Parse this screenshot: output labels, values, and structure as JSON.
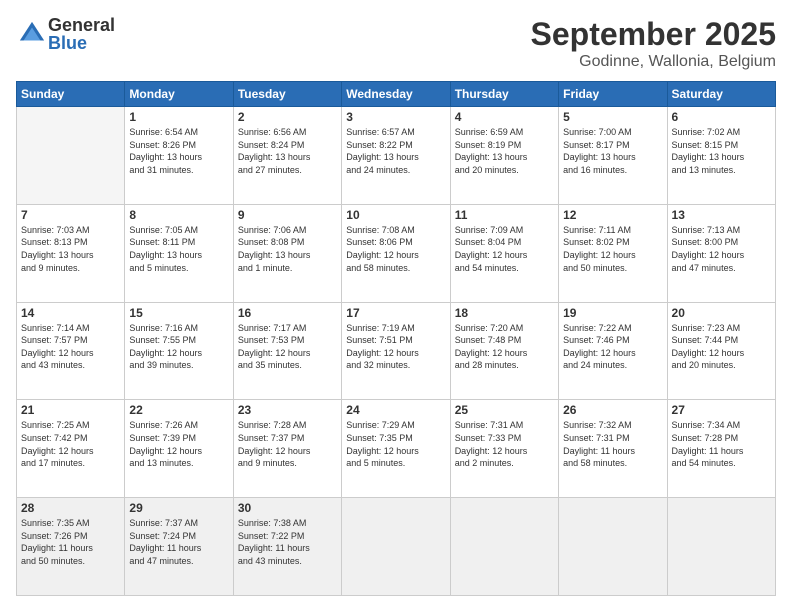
{
  "logo": {
    "general": "General",
    "blue": "Blue"
  },
  "header": {
    "month": "September 2025",
    "location": "Godinne, Wallonia, Belgium"
  },
  "weekdays": [
    "Sunday",
    "Monday",
    "Tuesday",
    "Wednesday",
    "Thursday",
    "Friday",
    "Saturday"
  ],
  "weeks": [
    [
      {
        "day": "",
        "info": ""
      },
      {
        "day": "1",
        "info": "Sunrise: 6:54 AM\nSunset: 8:26 PM\nDaylight: 13 hours\nand 31 minutes."
      },
      {
        "day": "2",
        "info": "Sunrise: 6:56 AM\nSunset: 8:24 PM\nDaylight: 13 hours\nand 27 minutes."
      },
      {
        "day": "3",
        "info": "Sunrise: 6:57 AM\nSunset: 8:22 PM\nDaylight: 13 hours\nand 24 minutes."
      },
      {
        "day": "4",
        "info": "Sunrise: 6:59 AM\nSunset: 8:19 PM\nDaylight: 13 hours\nand 20 minutes."
      },
      {
        "day": "5",
        "info": "Sunrise: 7:00 AM\nSunset: 8:17 PM\nDaylight: 13 hours\nand 16 minutes."
      },
      {
        "day": "6",
        "info": "Sunrise: 7:02 AM\nSunset: 8:15 PM\nDaylight: 13 hours\nand 13 minutes."
      }
    ],
    [
      {
        "day": "7",
        "info": "Sunrise: 7:03 AM\nSunset: 8:13 PM\nDaylight: 13 hours\nand 9 minutes."
      },
      {
        "day": "8",
        "info": "Sunrise: 7:05 AM\nSunset: 8:11 PM\nDaylight: 13 hours\nand 5 minutes."
      },
      {
        "day": "9",
        "info": "Sunrise: 7:06 AM\nSunset: 8:08 PM\nDaylight: 13 hours\nand 1 minute."
      },
      {
        "day": "10",
        "info": "Sunrise: 7:08 AM\nSunset: 8:06 PM\nDaylight: 12 hours\nand 58 minutes."
      },
      {
        "day": "11",
        "info": "Sunrise: 7:09 AM\nSunset: 8:04 PM\nDaylight: 12 hours\nand 54 minutes."
      },
      {
        "day": "12",
        "info": "Sunrise: 7:11 AM\nSunset: 8:02 PM\nDaylight: 12 hours\nand 50 minutes."
      },
      {
        "day": "13",
        "info": "Sunrise: 7:13 AM\nSunset: 8:00 PM\nDaylight: 12 hours\nand 47 minutes."
      }
    ],
    [
      {
        "day": "14",
        "info": "Sunrise: 7:14 AM\nSunset: 7:57 PM\nDaylight: 12 hours\nand 43 minutes."
      },
      {
        "day": "15",
        "info": "Sunrise: 7:16 AM\nSunset: 7:55 PM\nDaylight: 12 hours\nand 39 minutes."
      },
      {
        "day": "16",
        "info": "Sunrise: 7:17 AM\nSunset: 7:53 PM\nDaylight: 12 hours\nand 35 minutes."
      },
      {
        "day": "17",
        "info": "Sunrise: 7:19 AM\nSunset: 7:51 PM\nDaylight: 12 hours\nand 32 minutes."
      },
      {
        "day": "18",
        "info": "Sunrise: 7:20 AM\nSunset: 7:48 PM\nDaylight: 12 hours\nand 28 minutes."
      },
      {
        "day": "19",
        "info": "Sunrise: 7:22 AM\nSunset: 7:46 PM\nDaylight: 12 hours\nand 24 minutes."
      },
      {
        "day": "20",
        "info": "Sunrise: 7:23 AM\nSunset: 7:44 PM\nDaylight: 12 hours\nand 20 minutes."
      }
    ],
    [
      {
        "day": "21",
        "info": "Sunrise: 7:25 AM\nSunset: 7:42 PM\nDaylight: 12 hours\nand 17 minutes."
      },
      {
        "day": "22",
        "info": "Sunrise: 7:26 AM\nSunset: 7:39 PM\nDaylight: 12 hours\nand 13 minutes."
      },
      {
        "day": "23",
        "info": "Sunrise: 7:28 AM\nSunset: 7:37 PM\nDaylight: 12 hours\nand 9 minutes."
      },
      {
        "day": "24",
        "info": "Sunrise: 7:29 AM\nSunset: 7:35 PM\nDaylight: 12 hours\nand 5 minutes."
      },
      {
        "day": "25",
        "info": "Sunrise: 7:31 AM\nSunset: 7:33 PM\nDaylight: 12 hours\nand 2 minutes."
      },
      {
        "day": "26",
        "info": "Sunrise: 7:32 AM\nSunset: 7:31 PM\nDaylight: 11 hours\nand 58 minutes."
      },
      {
        "day": "27",
        "info": "Sunrise: 7:34 AM\nSunset: 7:28 PM\nDaylight: 11 hours\nand 54 minutes."
      }
    ],
    [
      {
        "day": "28",
        "info": "Sunrise: 7:35 AM\nSunset: 7:26 PM\nDaylight: 11 hours\nand 50 minutes."
      },
      {
        "day": "29",
        "info": "Sunrise: 7:37 AM\nSunset: 7:24 PM\nDaylight: 11 hours\nand 47 minutes."
      },
      {
        "day": "30",
        "info": "Sunrise: 7:38 AM\nSunset: 7:22 PM\nDaylight: 11 hours\nand 43 minutes."
      },
      {
        "day": "",
        "info": ""
      },
      {
        "day": "",
        "info": ""
      },
      {
        "day": "",
        "info": ""
      },
      {
        "day": "",
        "info": ""
      }
    ]
  ]
}
